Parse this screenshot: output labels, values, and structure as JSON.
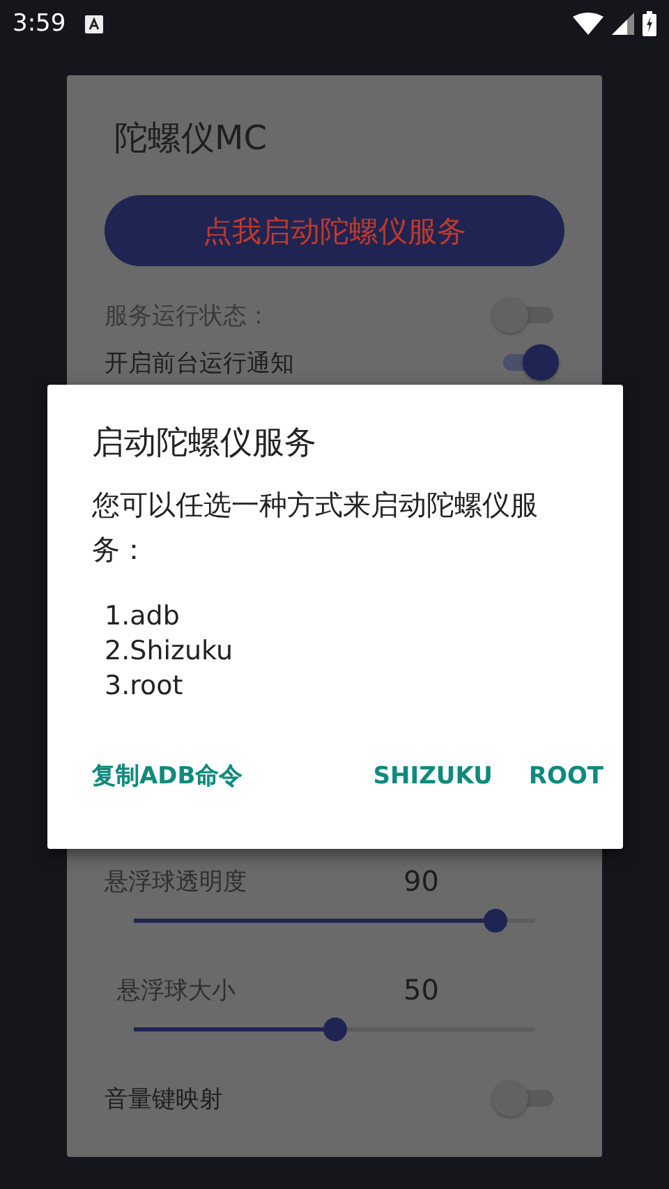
{
  "status_bar": {
    "time": "3:59"
  },
  "app": {
    "title": "陀螺仪MC",
    "start_button": "点我启动陀螺仪服务",
    "settings": [
      {
        "kind": "switch",
        "label": "服务运行状态：",
        "on": false,
        "disabled": true
      },
      {
        "kind": "switch",
        "label": "开启前台运行通知",
        "on": true,
        "disabled": false
      },
      {
        "kind": "slider",
        "label": "悬浮球透明度",
        "value": "90",
        "level": 0.9
      },
      {
        "kind": "slider",
        "label": "悬浮球大小",
        "value": "50",
        "level": 0.5
      },
      {
        "kind": "switch",
        "label": "音量键映射",
        "on": false,
        "disabled": false
      }
    ]
  },
  "dialog": {
    "title": "启动陀螺仪服务",
    "message": "您可以任选一种方式来启动陀螺仪服务：",
    "options": [
      "1.adb",
      "2.Shizuku",
      "3.root"
    ],
    "buttons": [
      {
        "label": "复制ADB命令"
      },
      {
        "label": "SHIZUKU"
      },
      {
        "label": "ROOT"
      }
    ]
  }
}
